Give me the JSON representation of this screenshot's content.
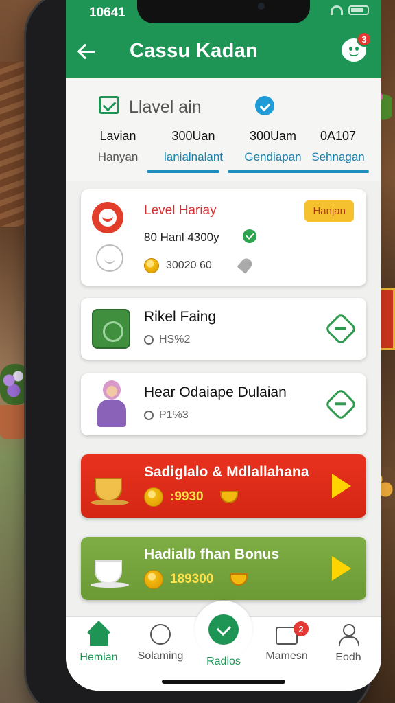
{
  "status_bar": {
    "time": "10641"
  },
  "header": {
    "title": "Cassu Kadan",
    "chat_badge": "3"
  },
  "level_section": {
    "title": "Llavel ain",
    "columns": [
      {
        "top": "Lavian",
        "bottom": "Hanyan"
      },
      {
        "top": "300Uan",
        "bottom": "lanialnalant"
      },
      {
        "top": "300Uam",
        "bottom": "Gendiapan"
      },
      {
        "top": "0A107",
        "bottom": "Sehnagan"
      }
    ]
  },
  "level_card": {
    "title": "Level Hariay",
    "badge": "Hanjan",
    "subtitle": "80 Hanl 4300y",
    "coins": "30020 60"
  },
  "rows": [
    {
      "title": "Rikel Faing",
      "sub": "HS%2"
    },
    {
      "title": "Hear Odaiape Dulaian",
      "sub": "P1%3"
    }
  ],
  "promos": [
    {
      "title": "Sadiglalo & Mdlallahana",
      "coins": ":9930",
      "color": "#e32b18"
    },
    {
      "title": "Hadialb fhan Bonus",
      "coins": "189300",
      "color": "#75a43e"
    }
  ],
  "bottom_nav": {
    "items": [
      {
        "label": "Hemian",
        "icon": "home-icon"
      },
      {
        "label": "Solaming",
        "icon": "search-icon"
      },
      {
        "label": "Radios",
        "icon": "check-circle-icon"
      },
      {
        "label": "Mamesn",
        "icon": "message-icon",
        "badge": "2"
      },
      {
        "label": "Eodh",
        "icon": "profile-icon"
      }
    ]
  },
  "colors": {
    "brand_green": "#1e9455",
    "accent_blue": "#1f8dbd",
    "alert_red": "#e53935"
  }
}
